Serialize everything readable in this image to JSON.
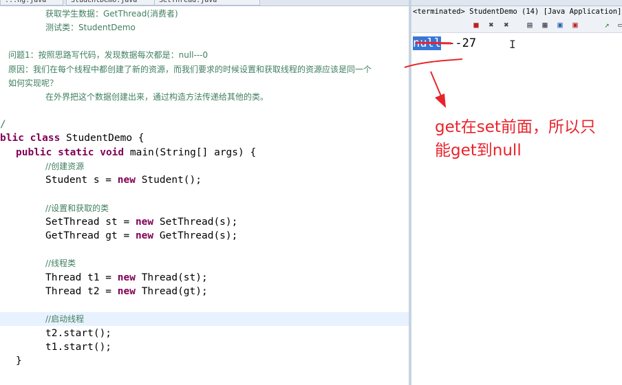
{
  "editor": {
    "tabs": [
      "...ng.java",
      "StudentDemo.java",
      "SetThread.java"
    ],
    "comment_lines": [
      "获取学生数据：GetThread(消费者)",
      "测试类：StudentDemo",
      "问题1：按照思路写代码，发现数据每次都是：null---0",
      "原因：我们在每个线程中都创建了新的资源，而我们要求的时候设置和获取线程的资源应该是同一个",
      "如何实现呢？",
      "在外界把这个数据创建出来，通过构造方法传递给其他的类。"
    ],
    "code": {
      "comment_end": "/",
      "class_kw": "blic class",
      "class_name": " StudentDemo {",
      "main_kw": "public static void",
      "main_sig": " main(String[] args) {",
      "c_create": "//创建资源",
      "l_student_a": "Student s = ",
      "new": "new",
      "l_student_b": " Student();",
      "c_set_get": "//设置和获取的类",
      "l_set_a": "SetThread st = ",
      "l_set_b": " SetThread(s);",
      "l_get_a": "GetThread gt = ",
      "l_get_b": " GetThread(s);",
      "c_thread": "//线程类",
      "l_t1_a": "Thread t1 = ",
      "l_t1_b": " Thread(st);",
      "l_t2_a": "Thread t2 = ",
      "l_t2_b": " Thread(gt);",
      "c_start": "//启动线程",
      "l_start2": "t2.start();",
      "l_start1": "t1.start();",
      "close_brace": "}"
    }
  },
  "console": {
    "header": "<terminated> StudentDemo (14) [Java Application]",
    "output_selected": "null",
    "output_rest": "---27"
  },
  "annotation": {
    "line1": "get在set前面，所以只",
    "line2": "能get到null",
    "color": "#e8242b"
  }
}
